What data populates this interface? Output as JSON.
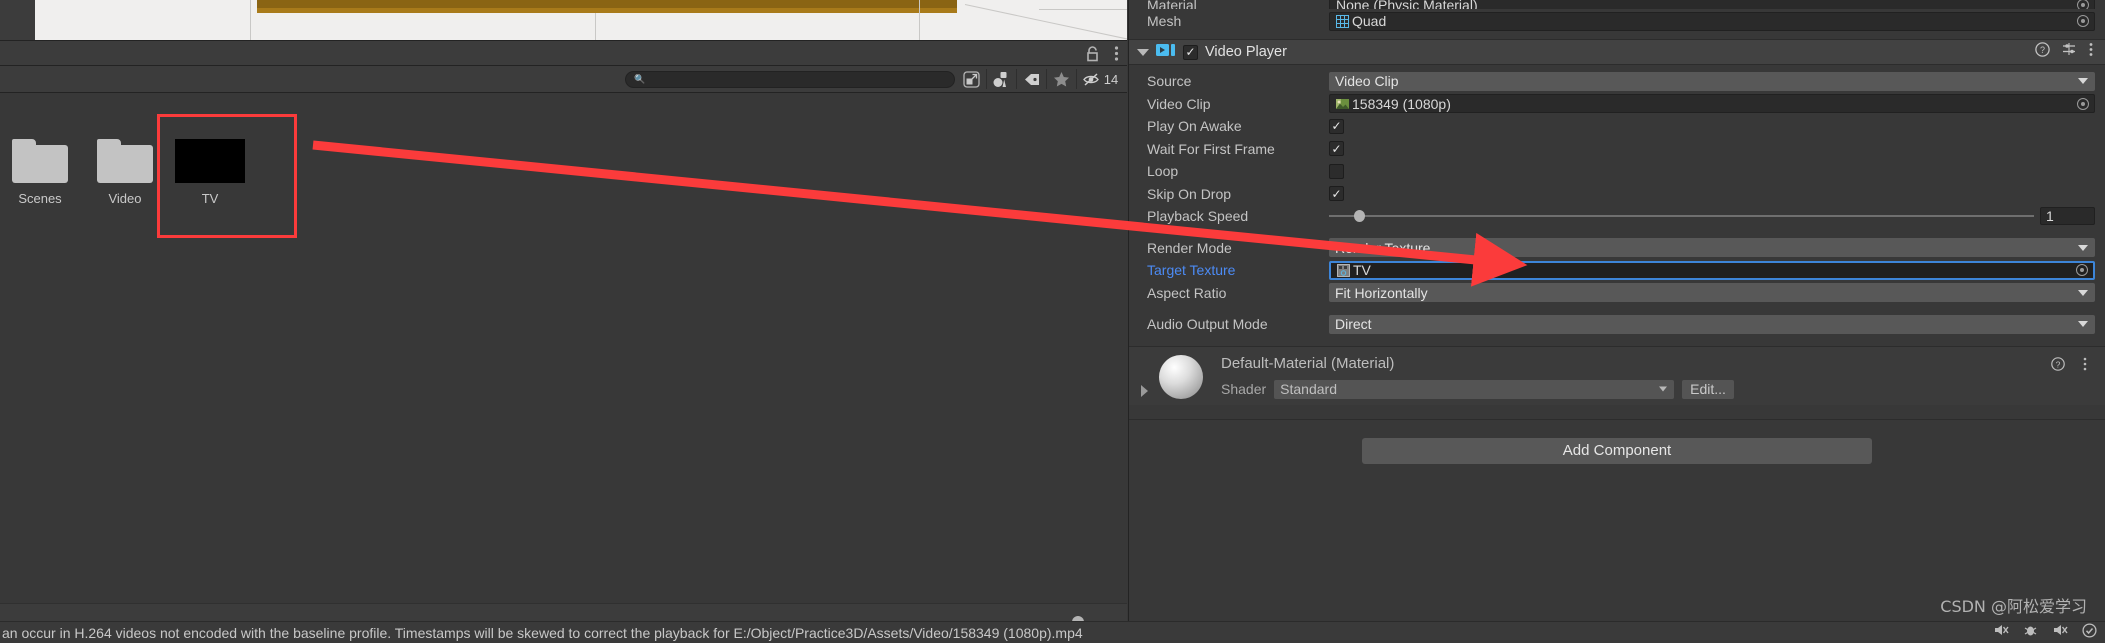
{
  "scene_view": {
    "name": "scene-preview"
  },
  "project_browser": {
    "toolbar": {
      "lock_icon": "lock-icon",
      "menu_icon": "kebab-menu-icon"
    },
    "search": {
      "placeholder": "",
      "value": "",
      "icon": "search-icon"
    },
    "filter_buttons": [
      {
        "name": "expand-search-icon",
        "label": ""
      },
      {
        "name": "asset-type-filter-icon",
        "label": ""
      },
      {
        "name": "label-filter-icon",
        "label": ""
      },
      {
        "name": "favorites-star-icon",
        "label": ""
      }
    ],
    "hidden_count": {
      "icon": "hidden-eye-icon",
      "value": "14"
    },
    "assets": [
      {
        "name": "Scenes",
        "type": "folder"
      },
      {
        "name": "Video",
        "type": "folder"
      },
      {
        "name": "TV",
        "type": "render-texture",
        "selected": true
      }
    ],
    "zoom_slider": {
      "value": 56
    }
  },
  "inspector": {
    "mesh_collider_rows": [
      {
        "label": "Material",
        "value": "None (Physic Material)",
        "type": "object"
      },
      {
        "label": "Mesh",
        "value": "Quad",
        "type": "object"
      }
    ],
    "video_player": {
      "title": "Video Player",
      "enabled": true,
      "icons": {
        "component": "video-player-icon",
        "help": "help-icon",
        "preset": "preset-icon",
        "menu": "kebab-menu-icon"
      },
      "rows": [
        {
          "label": "Source",
          "type": "dropdown",
          "value": "Video Clip"
        },
        {
          "label": "Video Clip",
          "type": "object",
          "value": "158349 (1080p)"
        },
        {
          "label": "Play On Awake",
          "type": "checkbox",
          "value": true
        },
        {
          "label": "Wait For First Frame",
          "type": "checkbox",
          "value": true
        },
        {
          "label": "Loop",
          "type": "checkbox",
          "value": false
        },
        {
          "label": "Skip On Drop",
          "type": "checkbox",
          "value": true
        },
        {
          "label": "Playback Speed",
          "type": "slider",
          "value": "1"
        },
        {
          "label": "Render Mode",
          "type": "dropdown",
          "value": "Render Texture"
        },
        {
          "label": "Target Texture",
          "type": "object",
          "value": "TV",
          "highlight": true
        },
        {
          "label": "Aspect Ratio",
          "type": "dropdown",
          "value": "Fit Horizontally"
        },
        {
          "label": "Audio Output Mode",
          "type": "dropdown",
          "value": "Direct"
        }
      ]
    },
    "material": {
      "title": "Default-Material (Material)",
      "shader_label": "Shader",
      "shader_value": "Standard",
      "edit_label": "Edit..."
    },
    "add_component_label": "Add Component"
  },
  "status_bar": {
    "message": "an occur in H.264 videos not encoded with the baseline profile. Timestamps will be skewed to correct the playback for E:/Object/Practice3D/Assets/Video/158349 (1080p).mp4"
  },
  "watermark": {
    "text": "CSDN @阿松爱学习"
  },
  "colors": {
    "accent_red": "#fb3b3b",
    "link_blue": "#4c8bf5",
    "highlight_border": "#3d85d8",
    "panel_bg": "#383838"
  }
}
